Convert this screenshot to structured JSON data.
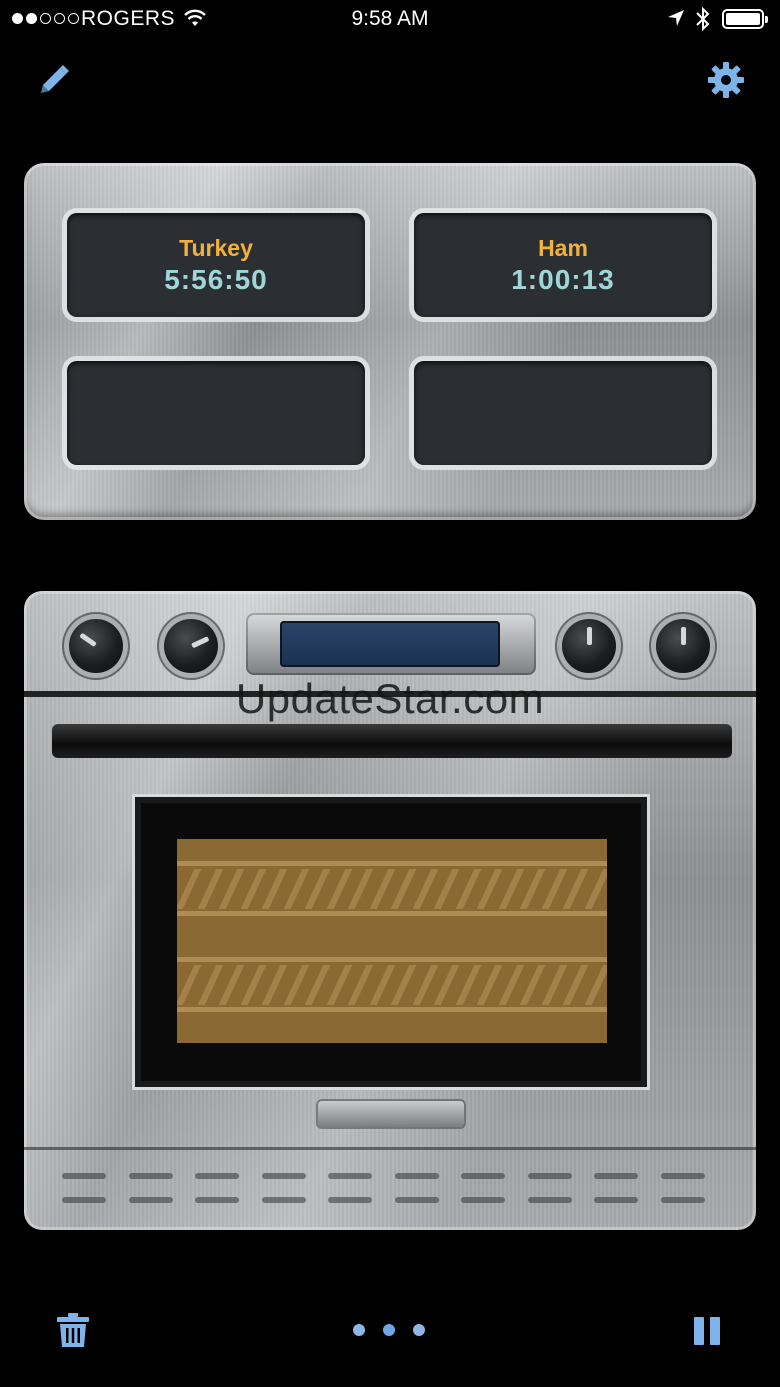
{
  "status_bar": {
    "carrier": "ROGERS",
    "time": "9:58 AM",
    "signal_bars_filled": 2,
    "signal_bars_total": 5
  },
  "header": {
    "edit_icon": "pencil-icon",
    "settings_icon": "gear-icon",
    "accent_color": "#7fb4ea"
  },
  "timers": [
    {
      "name": "Turkey",
      "countdown": "5:56:50"
    },
    {
      "name": "Ham",
      "countdown": "1:00:13"
    },
    {
      "name": "",
      "countdown": ""
    },
    {
      "name": "",
      "countdown": ""
    }
  ],
  "timer_colors": {
    "name": "#f2b13c",
    "countdown": "#9fd6d8"
  },
  "oven": {
    "watermark": "UpdateStar.com"
  },
  "toolbar": {
    "delete_icon": "trash-icon",
    "pause_icon": "pause-icon",
    "page_count": 3,
    "current_page": 2
  }
}
